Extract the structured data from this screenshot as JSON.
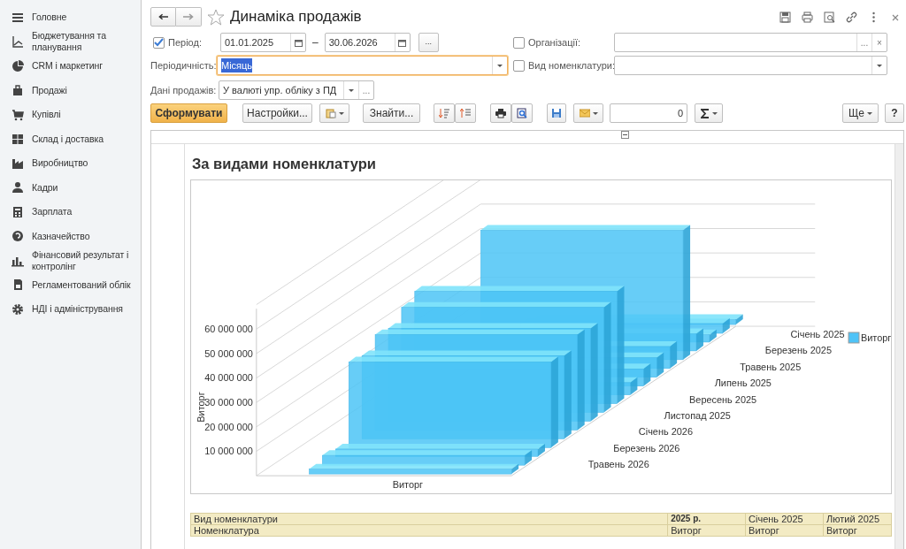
{
  "sidebar": {
    "items": [
      {
        "label": "Головне"
      },
      {
        "label": "Бюджетування та планування"
      },
      {
        "label": "CRM і маркетинг"
      },
      {
        "label": "Продажі"
      },
      {
        "label": "Купівлі"
      },
      {
        "label": "Склад і доставка"
      },
      {
        "label": "Виробництво"
      },
      {
        "label": "Кадри"
      },
      {
        "label": "Зарплата"
      },
      {
        "label": "Казначейство"
      },
      {
        "label": "Фінансовий результат і контролінг"
      },
      {
        "label": "Регламентований облік"
      },
      {
        "label": "НДІ і адміністрування"
      }
    ]
  },
  "window": {
    "title": "Динаміка продажів",
    "favorite": false
  },
  "filters": {
    "period": {
      "label": "Період:",
      "checked": true,
      "from": "01.01.2025",
      "dash": "–",
      "to": "30.06.2026",
      "more": "..."
    },
    "periodicity": {
      "label": "Періодичність:",
      "value": "Місяць",
      "focused": true,
      "value_selected": true
    },
    "sales_data": {
      "label": "Дані продажів:",
      "value": "У валюті упр. обліку з ПД",
      "more": "..."
    },
    "organizations": {
      "label": "Організації:",
      "checked": false,
      "more": "...",
      "clear": "×"
    },
    "item_kind": {
      "label": "Вид номенклатури:",
      "checked": false
    }
  },
  "toolbar": {
    "generate": "Сформувати",
    "settings": "Настройки...",
    "find": "Знайти...",
    "sum_value": "0",
    "more": "Ще",
    "help": "?"
  },
  "report": {
    "title": "За видами номенклатури",
    "chart": {
      "y_axis_title": "Виторг",
      "y_tick_labels": [
        "60 000 000",
        "50 000 000",
        "40 000 000",
        "30 000 000",
        "20 000 000",
        "10 000 000"
      ],
      "x_label": "Виторг",
      "depth_labels": [
        "Січень 2025",
        "Березень 2025",
        "Травень 2025",
        "Липень 2025",
        "Вересень 2025",
        "Листопад 2025",
        "Січень 2026",
        "Березень 2026",
        "Травень 2026"
      ],
      "legend": [
        {
          "label": "Виторг",
          "color": "#4fc3f7"
        }
      ]
    },
    "table": {
      "rows": [
        {
          "cells": [
            "Вид номенклатури",
            "2025 р.",
            "Січень 2025",
            "Лютий 2025"
          ]
        },
        {
          "cells": [
            "Номенклатура",
            "Виторг",
            "Виторг",
            "Виторг"
          ]
        }
      ]
    }
  }
}
